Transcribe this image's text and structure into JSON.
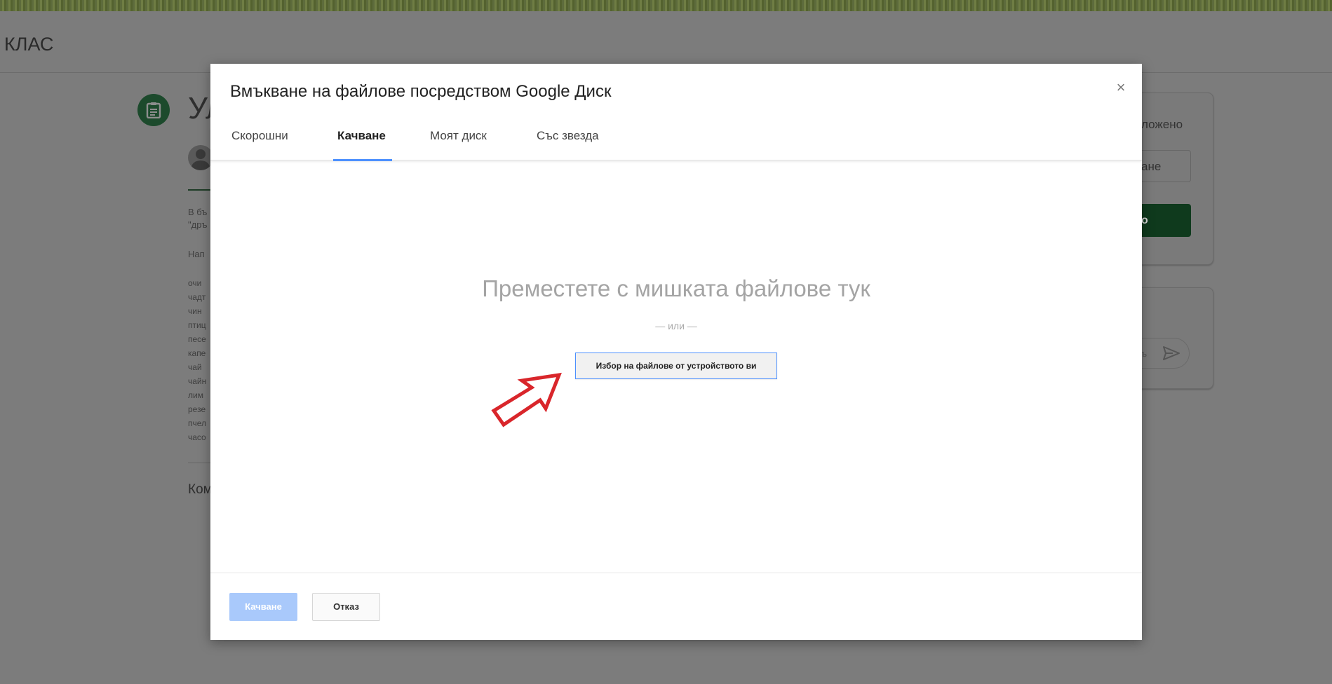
{
  "background": {
    "class_title": "КЛАС",
    "assignment_title": "Ул",
    "body_lines": [
      "В бъ",
      "\"дръ",
      "Нап"
    ],
    "words": [
      "очи",
      "чадт",
      "чин",
      "птиц",
      "песе",
      "капе",
      "чай",
      "чайн",
      "лим",
      "резе",
      "пчел",
      "часо"
    ],
    "comments_label": "Ком",
    "side": {
      "status_text": "ложено",
      "add_button_label": "ане",
      "done_button_label": "о",
      "comment_placeholder": "ъ"
    }
  },
  "modal": {
    "title": "Вмъкване на файлове посредством Google Диск",
    "close_label": "×",
    "tabs": [
      {
        "label": "Скорошни",
        "active": false
      },
      {
        "label": "Качване",
        "active": true
      },
      {
        "label": "Моят диск",
        "active": false
      },
      {
        "label": "Със звезда",
        "active": false
      }
    ],
    "drop_text": "Преместете с мишката файлове тук",
    "or_text": "— или —",
    "choose_button_label": "Избор на файлове от устройството ви",
    "upload_button_label": "Качване",
    "cancel_button_label": "Отказ"
  },
  "colors": {
    "accent_blue": "#4d90fe",
    "disabled_upload": "#a9c9fb",
    "arrow_red": "#d9262b",
    "overlay_gray": "#7c7c7c"
  }
}
